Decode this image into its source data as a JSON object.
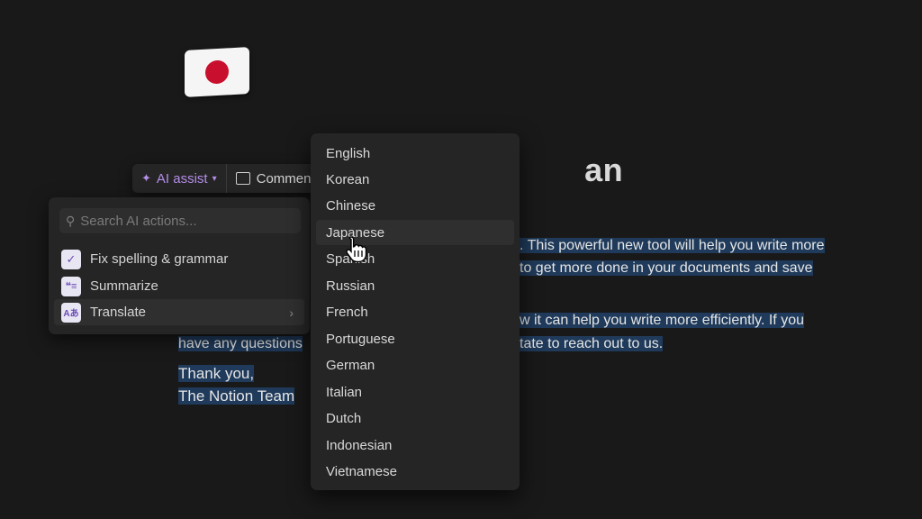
{
  "page": {
    "title_visible": "an",
    "paragraph1": {
      "line1_right": ". This powerful new tool will help you write more",
      "line2_right": "to get more done in your documents and save"
    },
    "paragraph2": {
      "line1_right": "w it can help you write more efficiently. If you",
      "line2_left": "have any questions",
      "line2_right": "tate to reach out to us."
    },
    "signoff": [
      "Thank you,",
      "The Notion Team"
    ]
  },
  "toolbar": {
    "ai_assist_label": "AI assist",
    "comment_label": "Commen"
  },
  "ai_menu": {
    "search_placeholder": "Search AI actions...",
    "items": [
      {
        "label": "Fix spelling & grammar",
        "icon": "check-icon"
      },
      {
        "label": "Summarize",
        "icon": "quote-lines-icon"
      },
      {
        "label": "Translate",
        "icon": "translate-icon"
      }
    ]
  },
  "language_menu": {
    "languages": [
      "English",
      "Korean",
      "Chinese",
      "Japanese",
      "Spanish",
      "Russian",
      "French",
      "Portuguese",
      "German",
      "Italian",
      "Dutch",
      "Indonesian",
      "Vietnamese"
    ],
    "hovered": "Japanese"
  },
  "colors": {
    "background": "#191919",
    "selection": "#1f3a5a",
    "ai_accent": "#b48ee8",
    "flag_red": "#c8102e"
  }
}
